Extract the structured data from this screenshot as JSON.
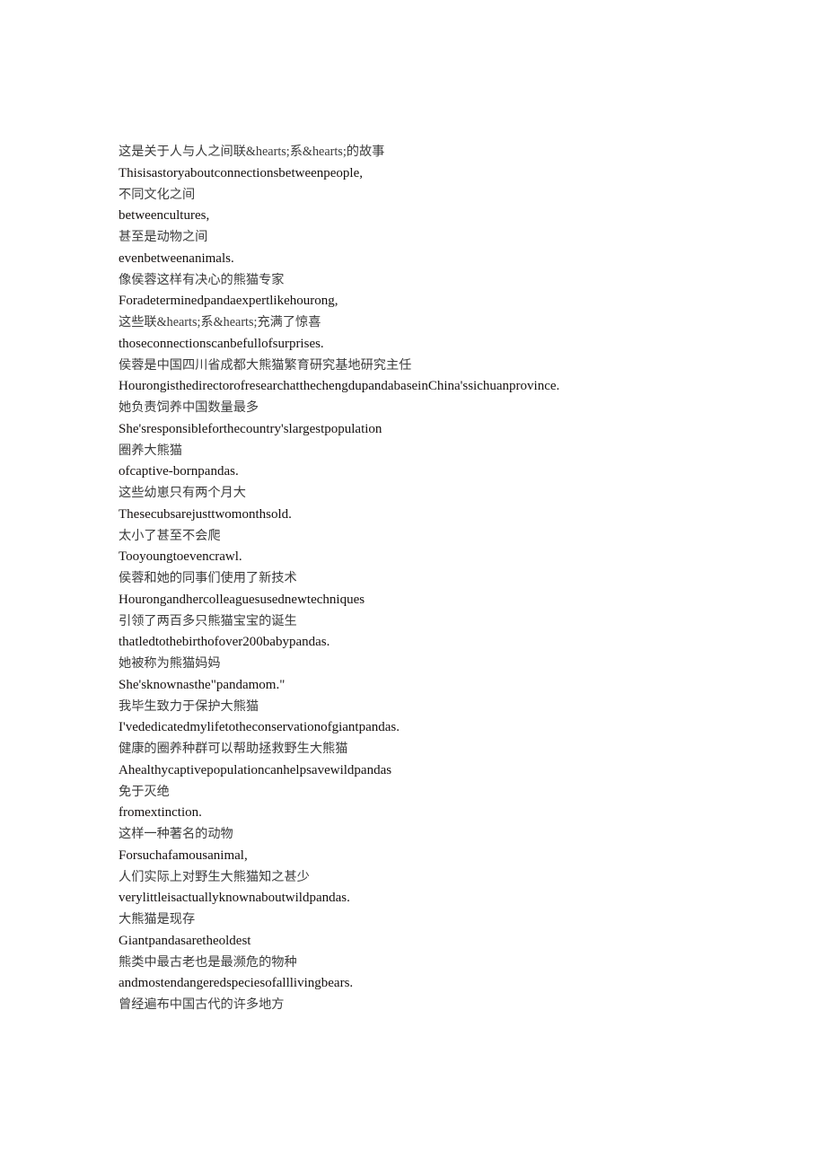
{
  "document": {
    "background_color": "#ffffff",
    "text_color_chinese": "#3c3c3c",
    "text_color_english": "#15100f",
    "lines": [
      {
        "lang": "zh",
        "text": "这是关于人与人之间联&hearts;系&hearts;的故事"
      },
      {
        "lang": "en",
        "text": "Thisisastoryaboutconnectionsbetweenpeople,"
      },
      {
        "lang": "zh",
        "text": "不同文化之间"
      },
      {
        "lang": "en",
        "text": "betweencultures,"
      },
      {
        "lang": "zh",
        "text": "甚至是动物之间"
      },
      {
        "lang": "en",
        "text": "evenbetweenanimals."
      },
      {
        "lang": "zh",
        "text": "像侯蓉这样有决心的熊猫专家"
      },
      {
        "lang": "en",
        "text": "Foradeterminedpandaexpertlikehourong,"
      },
      {
        "lang": "zh",
        "text": "这些联&hearts;系&hearts;充满了惊喜"
      },
      {
        "lang": "en",
        "text": "thoseconnectionscanbefullofsurprises."
      },
      {
        "lang": "zh",
        "text": "侯蓉是中国四川省成都大熊猫繁育研究基地研究主任"
      },
      {
        "lang": "en",
        "text": "HourongisthedirectorofresearchatthechengdupandabaseinChina'ssichuanprovince."
      },
      {
        "lang": "zh",
        "text": "她负责饲养中国数量最多"
      },
      {
        "lang": "en",
        "text": "She'sresponsibleforthecountry'slargestpopulation"
      },
      {
        "lang": "zh",
        "text": "圈养大熊猫"
      },
      {
        "lang": "en",
        "text": "ofcaptive-bornpandas."
      },
      {
        "lang": "zh",
        "text": "这些幼崽只有两个月大"
      },
      {
        "lang": "en",
        "text": "Thesecubsarejusttwomonthsold."
      },
      {
        "lang": "zh",
        "text": "太小了甚至不会爬"
      },
      {
        "lang": "en",
        "text": "Tooyoungtoevencrawl."
      },
      {
        "lang": "zh",
        "text": "侯蓉和她的同事们使用了新技术"
      },
      {
        "lang": "en",
        "text": "Hourongandhercolleaguesusednewtechniques"
      },
      {
        "lang": "zh",
        "text": "引领了两百多只熊猫宝宝的诞生"
      },
      {
        "lang": "en",
        "text": "thatledtothebirthofover200babypandas."
      },
      {
        "lang": "zh",
        "text": "她被称为熊猫妈妈"
      },
      {
        "lang": "en",
        "text": "She'sknownasthe\"pandamom.\""
      },
      {
        "lang": "zh",
        "text": "我毕生致力于保护大熊猫"
      },
      {
        "lang": "en",
        "text": "I'vededicatedmylifetotheconservationofgiantpandas."
      },
      {
        "lang": "zh",
        "text": "健康的圈养种群可以帮助拯救野生大熊猫"
      },
      {
        "lang": "en",
        "text": "Ahealthycaptivepopulationcanhelpsavewildpandas"
      },
      {
        "lang": "zh",
        "text": "免于灭绝"
      },
      {
        "lang": "en",
        "text": "fromextinction."
      },
      {
        "lang": "zh",
        "text": "这样一种著名的动物"
      },
      {
        "lang": "en",
        "text": "Forsuchafamousanimal,"
      },
      {
        "lang": "zh",
        "text": "人们实际上对野生大熊猫知之甚少"
      },
      {
        "lang": "en",
        "text": "verylittleisactuallyknownaboutwildpandas."
      },
      {
        "lang": "zh",
        "text": "大熊猫是现存"
      },
      {
        "lang": "en",
        "text": "Giantpandasaretheoldest"
      },
      {
        "lang": "zh",
        "text": "熊类中最古老也是最濒危的物种"
      },
      {
        "lang": "en",
        "text": "andmostendangeredspeciesofalllivingbears."
      },
      {
        "lang": "zh",
        "text": "曾经遍布中国古代的许多地方"
      }
    ]
  }
}
